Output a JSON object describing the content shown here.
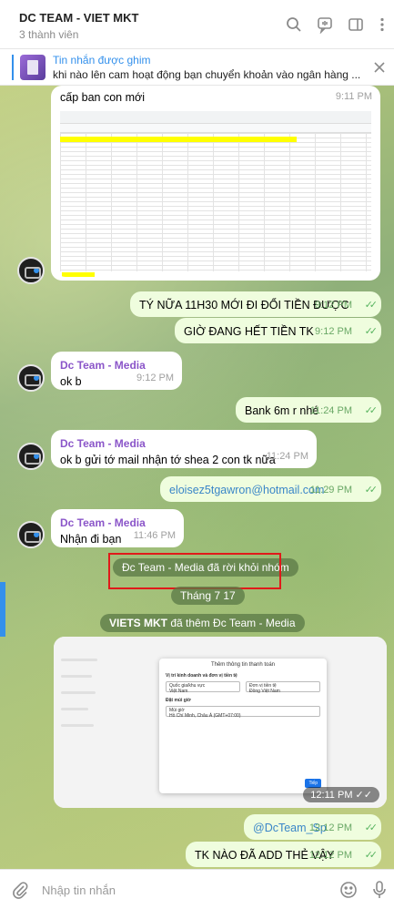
{
  "header": {
    "title": "DC TEAM - VIET MKT",
    "members": "3 thành viên"
  },
  "pinned": {
    "title": "Tin nhắn được ghim",
    "text": "khi nào lên cam hoạt động bạn chuyển khoản vào ngân hàng ..."
  },
  "messages": {
    "m1_text": "cấp ban con mới",
    "m1_time": "9:11 PM",
    "m2_text": "TÝ NỮA 11H30 MỚI ĐI ĐỔI TIỀN ĐƯỢC",
    "m2_time": "9:12 PM",
    "m3_text": "GIỜ ĐANG HẾT TIỀN TK",
    "m3_time": "9:12 PM",
    "m4_sender": "Dc Team - Media",
    "m4_text": "ok b",
    "m4_time": "9:12 PM",
    "m5_text": "Bank 6m r nhé",
    "m5_time": "11:24 PM",
    "m6_sender": "Dc Team - Media",
    "m6_text": "ok b gửi tớ mail nhận tớ shea 2 con tk nữa",
    "m6_time": "11:24 PM",
    "m7_text": "eloisez5tgawron@hotmail.com",
    "m7_time": "11:29 PM",
    "m8_sender": "Dc Team - Media",
    "m8_text": "Nhận đi bạn",
    "m8_time": "11:46 PM",
    "sys_left": "Đc Team - Media đã rời khỏi nhóm",
    "date_sep": "Tháng 7 17",
    "sys_added_actor": "VIETS MKT",
    "sys_added_rest": " đã thêm Đc Team - Media",
    "img_time": "12:11 PM",
    "m9_text": "@DcTeam_Sp",
    "m9_time": "12:12 PM",
    "m10_text": "TK NÀO ĐÃ ADD THẺ VẬY",
    "m10_time": "12:12 PM"
  },
  "form_shot": {
    "dialog_title": "Thêm thông tin thanh toán",
    "section1": "Vị trí kinh doanh và đơn vị tiền tệ",
    "country_label": "Quốc gia/khu vực",
    "country_value": "Việt Nam",
    "currency_label": "Đơn vị tiền tệ",
    "currency_value": "Đồng Việt Nam",
    "section2": "Đặt múi giờ",
    "timezone_label": "Múi giờ",
    "timezone_value": "Hồ Chí Minh, Châu Á (GMT+07:00)",
    "next_button": "Tiếp"
  },
  "composer": {
    "placeholder": "Nhập tin nhắn"
  },
  "colors": {
    "accent": "#3390ec",
    "outgoing_bubble": "#effdde",
    "sender_name": "#8b56c9",
    "read_check": "#59b460",
    "highlight_box": "#e01a1a"
  },
  "icons": [
    "search-icon",
    "voice-chat-icon",
    "sidebar-toggle-icon",
    "more-vertical-icon",
    "close-icon",
    "attach-icon",
    "emoji-icon",
    "mic-icon"
  ]
}
